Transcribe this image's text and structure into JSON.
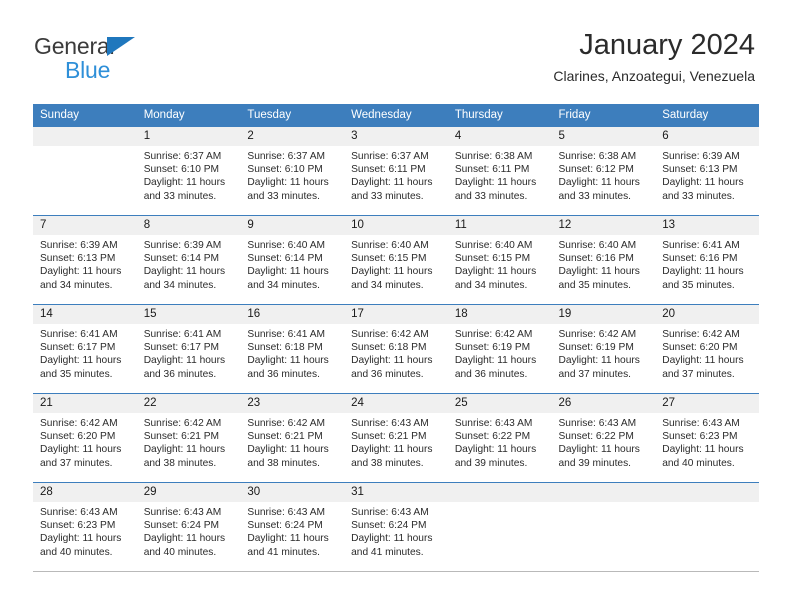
{
  "brand": {
    "name_part1": "General",
    "name_part2": "Blue",
    "color_dark": "#3b3b3b",
    "color_blue": "#2e8fd8",
    "triangle_color": "#1f77bd"
  },
  "header": {
    "title": "January 2024",
    "subtitle": "Clarines, Anzoategui, Venezuela"
  },
  "theme": {
    "header_row_bg": "#3d7ebd",
    "header_row_text": "#ffffff",
    "daynum_bg": "#f0f0f0",
    "grid_line": "#3d7ebd",
    "body_text": "#2b2b2b"
  },
  "weekday_headers": [
    "Sunday",
    "Monday",
    "Tuesday",
    "Wednesday",
    "Thursday",
    "Friday",
    "Saturday"
  ],
  "weeks": [
    [
      {
        "day": "",
        "sunrise": "",
        "sunset": "",
        "daylight_line1": "",
        "daylight_line2": "",
        "empty": true
      },
      {
        "day": "1",
        "sunrise": "Sunrise: 6:37 AM",
        "sunset": "Sunset: 6:10 PM",
        "daylight_line1": "Daylight: 11 hours",
        "daylight_line2": "and 33 minutes."
      },
      {
        "day": "2",
        "sunrise": "Sunrise: 6:37 AM",
        "sunset": "Sunset: 6:10 PM",
        "daylight_line1": "Daylight: 11 hours",
        "daylight_line2": "and 33 minutes."
      },
      {
        "day": "3",
        "sunrise": "Sunrise: 6:37 AM",
        "sunset": "Sunset: 6:11 PM",
        "daylight_line1": "Daylight: 11 hours",
        "daylight_line2": "and 33 minutes."
      },
      {
        "day": "4",
        "sunrise": "Sunrise: 6:38 AM",
        "sunset": "Sunset: 6:11 PM",
        "daylight_line1": "Daylight: 11 hours",
        "daylight_line2": "and 33 minutes."
      },
      {
        "day": "5",
        "sunrise": "Sunrise: 6:38 AM",
        "sunset": "Sunset: 6:12 PM",
        "daylight_line1": "Daylight: 11 hours",
        "daylight_line2": "and 33 minutes."
      },
      {
        "day": "6",
        "sunrise": "Sunrise: 6:39 AM",
        "sunset": "Sunset: 6:13 PM",
        "daylight_line1": "Daylight: 11 hours",
        "daylight_line2": "and 33 minutes."
      }
    ],
    [
      {
        "day": "7",
        "sunrise": "Sunrise: 6:39 AM",
        "sunset": "Sunset: 6:13 PM",
        "daylight_line1": "Daylight: 11 hours",
        "daylight_line2": "and 34 minutes."
      },
      {
        "day": "8",
        "sunrise": "Sunrise: 6:39 AM",
        "sunset": "Sunset: 6:14 PM",
        "daylight_line1": "Daylight: 11 hours",
        "daylight_line2": "and 34 minutes."
      },
      {
        "day": "9",
        "sunrise": "Sunrise: 6:40 AM",
        "sunset": "Sunset: 6:14 PM",
        "daylight_line1": "Daylight: 11 hours",
        "daylight_line2": "and 34 minutes."
      },
      {
        "day": "10",
        "sunrise": "Sunrise: 6:40 AM",
        "sunset": "Sunset: 6:15 PM",
        "daylight_line1": "Daylight: 11 hours",
        "daylight_line2": "and 34 minutes."
      },
      {
        "day": "11",
        "sunrise": "Sunrise: 6:40 AM",
        "sunset": "Sunset: 6:15 PM",
        "daylight_line1": "Daylight: 11 hours",
        "daylight_line2": "and 34 minutes."
      },
      {
        "day": "12",
        "sunrise": "Sunrise: 6:40 AM",
        "sunset": "Sunset: 6:16 PM",
        "daylight_line1": "Daylight: 11 hours",
        "daylight_line2": "and 35 minutes."
      },
      {
        "day": "13",
        "sunrise": "Sunrise: 6:41 AM",
        "sunset": "Sunset: 6:16 PM",
        "daylight_line1": "Daylight: 11 hours",
        "daylight_line2": "and 35 minutes."
      }
    ],
    [
      {
        "day": "14",
        "sunrise": "Sunrise: 6:41 AM",
        "sunset": "Sunset: 6:17 PM",
        "daylight_line1": "Daylight: 11 hours",
        "daylight_line2": "and 35 minutes."
      },
      {
        "day": "15",
        "sunrise": "Sunrise: 6:41 AM",
        "sunset": "Sunset: 6:17 PM",
        "daylight_line1": "Daylight: 11 hours",
        "daylight_line2": "and 36 minutes."
      },
      {
        "day": "16",
        "sunrise": "Sunrise: 6:41 AM",
        "sunset": "Sunset: 6:18 PM",
        "daylight_line1": "Daylight: 11 hours",
        "daylight_line2": "and 36 minutes."
      },
      {
        "day": "17",
        "sunrise": "Sunrise: 6:42 AM",
        "sunset": "Sunset: 6:18 PM",
        "daylight_line1": "Daylight: 11 hours",
        "daylight_line2": "and 36 minutes."
      },
      {
        "day": "18",
        "sunrise": "Sunrise: 6:42 AM",
        "sunset": "Sunset: 6:19 PM",
        "daylight_line1": "Daylight: 11 hours",
        "daylight_line2": "and 36 minutes."
      },
      {
        "day": "19",
        "sunrise": "Sunrise: 6:42 AM",
        "sunset": "Sunset: 6:19 PM",
        "daylight_line1": "Daylight: 11 hours",
        "daylight_line2": "and 37 minutes."
      },
      {
        "day": "20",
        "sunrise": "Sunrise: 6:42 AM",
        "sunset": "Sunset: 6:20 PM",
        "daylight_line1": "Daylight: 11 hours",
        "daylight_line2": "and 37 minutes."
      }
    ],
    [
      {
        "day": "21",
        "sunrise": "Sunrise: 6:42 AM",
        "sunset": "Sunset: 6:20 PM",
        "daylight_line1": "Daylight: 11 hours",
        "daylight_line2": "and 37 minutes."
      },
      {
        "day": "22",
        "sunrise": "Sunrise: 6:42 AM",
        "sunset": "Sunset: 6:21 PM",
        "daylight_line1": "Daylight: 11 hours",
        "daylight_line2": "and 38 minutes."
      },
      {
        "day": "23",
        "sunrise": "Sunrise: 6:42 AM",
        "sunset": "Sunset: 6:21 PM",
        "daylight_line1": "Daylight: 11 hours",
        "daylight_line2": "and 38 minutes."
      },
      {
        "day": "24",
        "sunrise": "Sunrise: 6:43 AM",
        "sunset": "Sunset: 6:21 PM",
        "daylight_line1": "Daylight: 11 hours",
        "daylight_line2": "and 38 minutes."
      },
      {
        "day": "25",
        "sunrise": "Sunrise: 6:43 AM",
        "sunset": "Sunset: 6:22 PM",
        "daylight_line1": "Daylight: 11 hours",
        "daylight_line2": "and 39 minutes."
      },
      {
        "day": "26",
        "sunrise": "Sunrise: 6:43 AM",
        "sunset": "Sunset: 6:22 PM",
        "daylight_line1": "Daylight: 11 hours",
        "daylight_line2": "and 39 minutes."
      },
      {
        "day": "27",
        "sunrise": "Sunrise: 6:43 AM",
        "sunset": "Sunset: 6:23 PM",
        "daylight_line1": "Daylight: 11 hours",
        "daylight_line2": "and 40 minutes."
      }
    ],
    [
      {
        "day": "28",
        "sunrise": "Sunrise: 6:43 AM",
        "sunset": "Sunset: 6:23 PM",
        "daylight_line1": "Daylight: 11 hours",
        "daylight_line2": "and 40 minutes."
      },
      {
        "day": "29",
        "sunrise": "Sunrise: 6:43 AM",
        "sunset": "Sunset: 6:24 PM",
        "daylight_line1": "Daylight: 11 hours",
        "daylight_line2": "and 40 minutes."
      },
      {
        "day": "30",
        "sunrise": "Sunrise: 6:43 AM",
        "sunset": "Sunset: 6:24 PM",
        "daylight_line1": "Daylight: 11 hours",
        "daylight_line2": "and 41 minutes."
      },
      {
        "day": "31",
        "sunrise": "Sunrise: 6:43 AM",
        "sunset": "Sunset: 6:24 PM",
        "daylight_line1": "Daylight: 11 hours",
        "daylight_line2": "and 41 minutes."
      },
      {
        "day": "",
        "sunrise": "",
        "sunset": "",
        "daylight_line1": "",
        "daylight_line2": "",
        "empty": true
      },
      {
        "day": "",
        "sunrise": "",
        "sunset": "",
        "daylight_line1": "",
        "daylight_line2": "",
        "empty": true
      },
      {
        "day": "",
        "sunrise": "",
        "sunset": "",
        "daylight_line1": "",
        "daylight_line2": "",
        "empty": true
      }
    ]
  ]
}
